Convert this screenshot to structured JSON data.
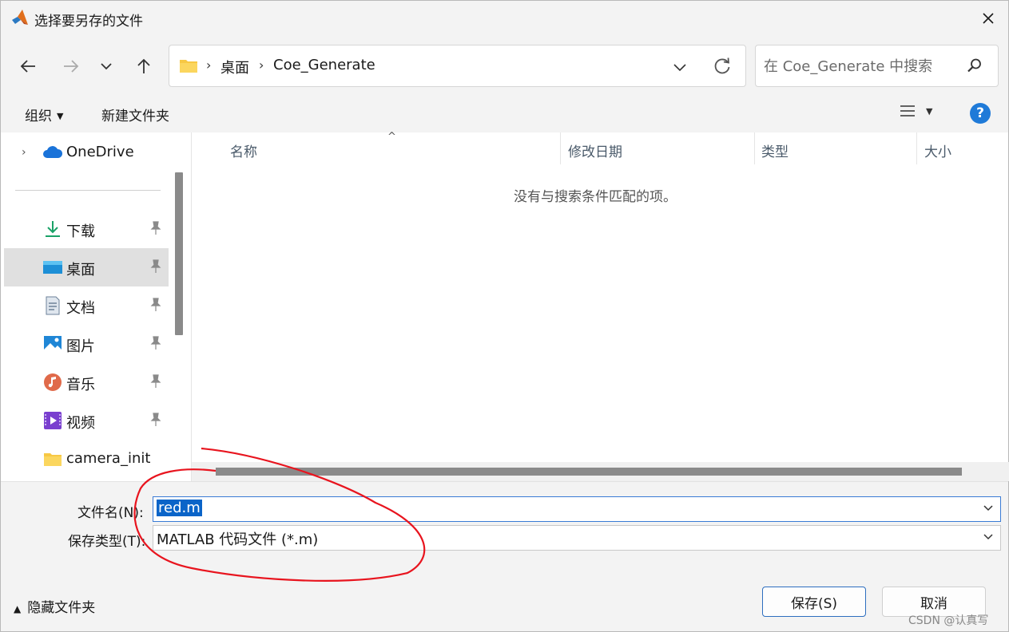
{
  "window": {
    "title": "选择要另存的文件"
  },
  "nav": {
    "breadcrumbs": [
      "桌面",
      "Coe_Generate"
    ],
    "search_placeholder": "在 Coe_Generate 中搜索"
  },
  "toolbar": {
    "organize_label": "组织",
    "new_folder_label": "新建文件夹"
  },
  "sidebar": {
    "top_item": {
      "label": "OneDrive",
      "icon": "cloud-icon"
    },
    "items": [
      {
        "label": "下载",
        "icon": "download-icon",
        "pinned": true
      },
      {
        "label": "桌面",
        "icon": "desktop-icon",
        "pinned": true,
        "selected": true
      },
      {
        "label": "文档",
        "icon": "document-icon",
        "pinned": true
      },
      {
        "label": "图片",
        "icon": "picture-icon",
        "pinned": true
      },
      {
        "label": "音乐",
        "icon": "music-icon",
        "pinned": true
      },
      {
        "label": "视频",
        "icon": "video-icon",
        "pinned": true
      },
      {
        "label": "camera_init",
        "icon": "folder-icon",
        "pinned": false
      }
    ]
  },
  "filelist": {
    "columns": [
      "名称",
      "修改日期",
      "类型",
      "大小"
    ],
    "empty_message": "没有与搜索条件匹配的项。"
  },
  "form": {
    "filename_label": "文件名(N):",
    "filename_value": "red.m",
    "filetype_label": "保存类型(T):",
    "filetype_value": "MATLAB 代码文件 (*.m)"
  },
  "footer": {
    "hide_folders_label": "隐藏文件夹",
    "save_label": "保存(S)",
    "cancel_label": "取消",
    "watermark": "CSDN @认真写"
  },
  "colors": {
    "accent": "#1f7ad8",
    "selection": "#0a64c8",
    "annotation": "#e8141e"
  }
}
